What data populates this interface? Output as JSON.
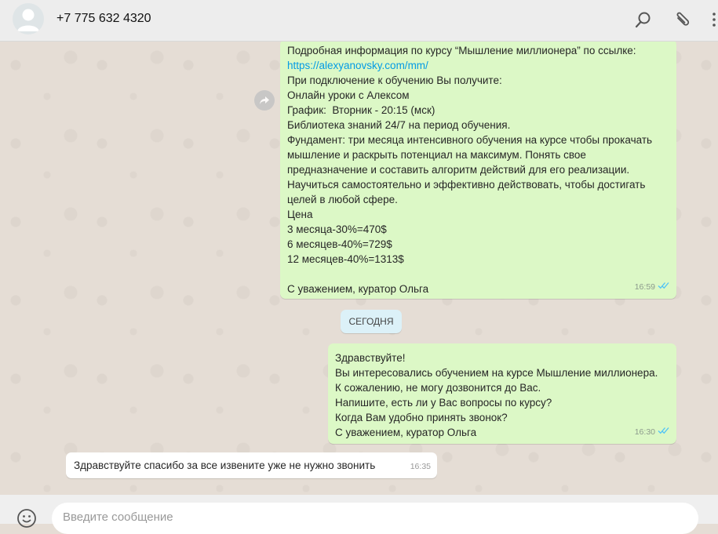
{
  "header": {
    "contact_name": "+7 775 632 4320",
    "icons": [
      "avatar-icon",
      "search-icon",
      "attach-icon",
      "menu-icon"
    ]
  },
  "chat": {
    "messages": [
      {
        "direction": "outgoing",
        "lines": [
          "Подробная информация по курсу “Мышление миллионера” по ссылке:",
          "https://alexyanovsky.com/mm/",
          "При подключение к обучению Вы получите:",
          "Онлайн уроки с Алексом",
          "График:  Вторник - 20:15 (мск)",
          "Библиотека знаний 24/7 на период обучения.",
          "Фундамент: три месяца интенсивного обучения на курсе чтобы прокачать",
          "мышление и раскрыть потенциал на максимум. Понять свое",
          "предназначение и составить алгоритм действий для его реализации.",
          "Научиться самостоятельно и эффективно действовать, чтобы достигать",
          "целей в любой сфере.",
          "Цена",
          "3 месяца-30%=470$",
          "6 месяцев-40%=729$",
          "12 месяцев-40%=1313$",
          "",
          "С уважением, куратор Ольга"
        ],
        "time": "16:59",
        "status_icon": "double-check-icon"
      },
      {
        "direction": "outgoing",
        "lines": [
          "Здравствуйте!",
          "Вы интересовались обучением на курсе Мышление миллионера.",
          "К сожалению, не могу дозвонится до Вас.",
          "Напишите, есть ли у Вас вопросы по курсу?",
          "Когда Вам удобно принять звонок?",
          "С уважением, куратор Ольга"
        ],
        "time": "16:30",
        "status_icon": "double-check-icon"
      },
      {
        "direction": "incoming",
        "lines": [
          "Здравствуйте спасибо за все извените уже не нужно звонить"
        ],
        "time": "16:35"
      }
    ],
    "date_divider": "СЕГОДНЯ"
  },
  "composer": {
    "placeholder": "Введите сообщение",
    "value": "",
    "icons": [
      "emoji-icon"
    ]
  },
  "colors": {
    "outgoing_bubble": "#dcf8c6",
    "incoming_bubble": "#ffffff",
    "link": "#039be5",
    "read_check": "#4fc3f7"
  }
}
